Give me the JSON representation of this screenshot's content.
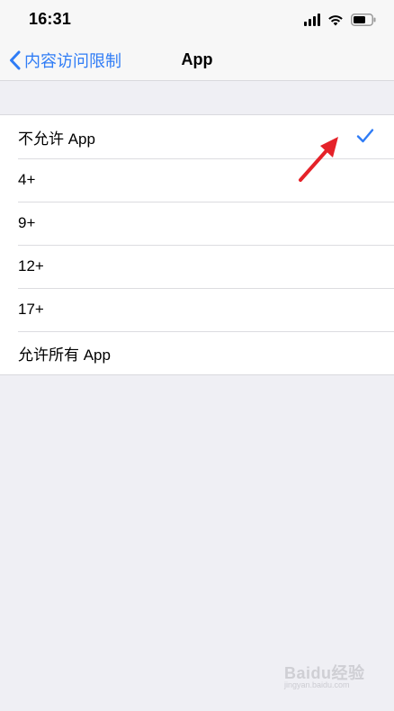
{
  "status_bar": {
    "time": "16:31"
  },
  "nav": {
    "back_label": "内容访问限制",
    "title": "App"
  },
  "options": [
    {
      "label": "不允许 App",
      "selected": true
    },
    {
      "label": "4+",
      "selected": false
    },
    {
      "label": "9+",
      "selected": false
    },
    {
      "label": "12+",
      "selected": false
    },
    {
      "label": "17+",
      "selected": false
    },
    {
      "label": "允许所有 App",
      "selected": false
    }
  ],
  "colors": {
    "accent": "#2f7cf6",
    "background": "#efeff4",
    "annotation_arrow": "#e52229"
  },
  "watermark": {
    "brand": "Baidu经验",
    "url": "jingyan.baidu.com"
  }
}
